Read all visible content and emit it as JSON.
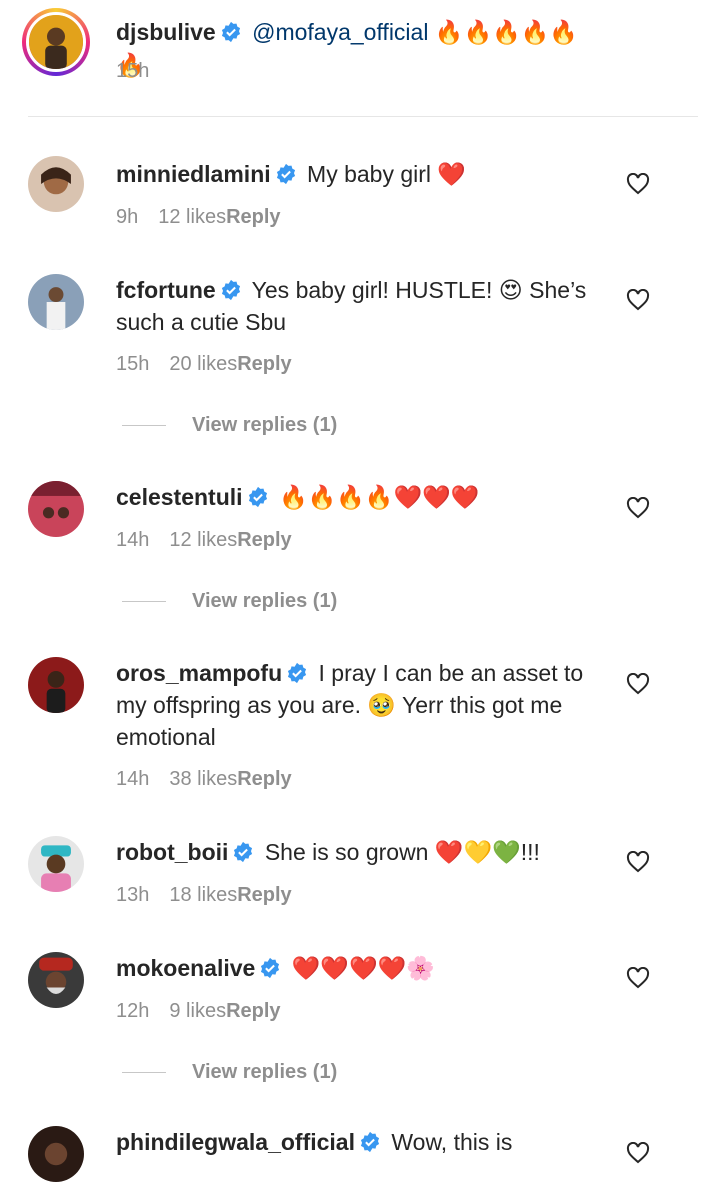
{
  "caption": {
    "username": "djsbulive",
    "mention": "@mofaya_official",
    "emojis": "🔥🔥🔥🔥🔥🔥",
    "time": "15h"
  },
  "comments": [
    {
      "username": "minniedlamini",
      "text": "My baby girl ❤️",
      "time": "9h",
      "likes": "12 likes",
      "reply": "Reply"
    },
    {
      "username": "fcfortune",
      "text": "Yes baby girl! HUSTLE! 😍 She’s such a cutie Sbu",
      "time": "15h",
      "likes": "20 likes",
      "reply": "Reply",
      "view_replies": "View replies (1)"
    },
    {
      "username": "celestentuli",
      "text": "🔥🔥🔥🔥❤️❤️❤️",
      "time": "14h",
      "likes": "12 likes",
      "reply": "Reply",
      "view_replies": "View replies (1)"
    },
    {
      "username": "oros_mampofu",
      "text": "I pray I can be an asset to my offspring as you are. 🥹 Yerr this got me emotional",
      "time": "14h",
      "likes": "38 likes",
      "reply": "Reply"
    },
    {
      "username": "robot_boii",
      "text": "She is so grown ❤️💛💚!!!",
      "time": "13h",
      "likes": "18 likes",
      "reply": "Reply"
    },
    {
      "username": "mokoenalive",
      "text": "❤️❤️❤️❤️🌸",
      "time": "12h",
      "likes": "9 likes",
      "reply": "Reply",
      "view_replies": "View replies (1)"
    },
    {
      "username": "phindilegwala_official",
      "text": "Wow, this is"
    }
  ],
  "colors": {
    "verified": "#3897f0",
    "meta": "#8e8e8e",
    "text": "#262626"
  }
}
